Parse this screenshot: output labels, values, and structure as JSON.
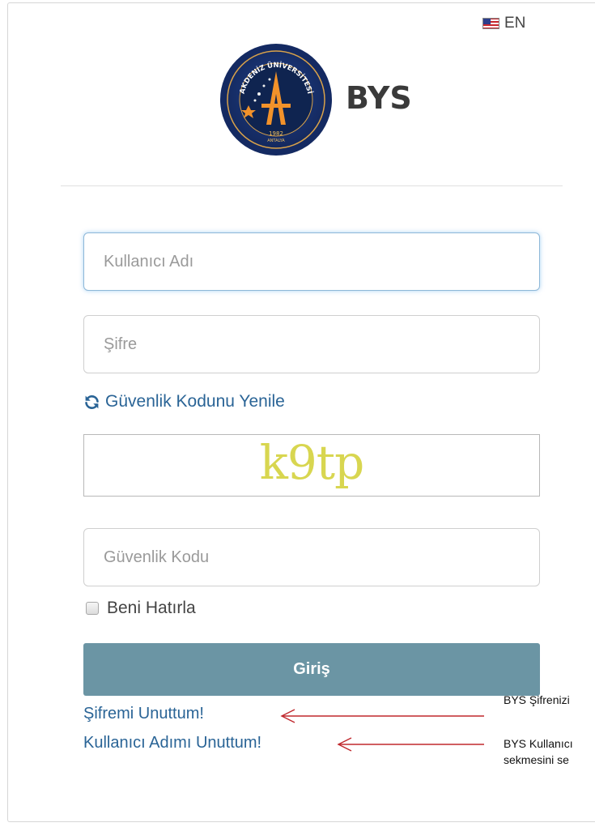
{
  "language": {
    "label": "EN",
    "flag": "us-flag-icon"
  },
  "logo": {
    "arc_text": "AKDENİZ ÜNİVERSİTESİ",
    "year": "1982",
    "city": "ANTALYA",
    "brand": "BYS"
  },
  "form": {
    "username_placeholder": "Kullanıcı Adı",
    "password_placeholder": "Şifre",
    "refresh_label": "Güvenlik Kodunu Yenile",
    "captcha_image_text": "k9tp",
    "captcha_placeholder": "Güvenlik Kodu",
    "remember_label": "Beni Hatırla",
    "submit_label": "Giriş",
    "forgot_password": "Şifremi Unuttum!",
    "forgot_username": "Kullanıcı Adımı Unuttum!"
  },
  "annotations": {
    "password_note": "BYS Şifrenizi",
    "username_note_line1": "BYS Kullanıcı",
    "username_note_line2": "sekmesini se"
  },
  "colors": {
    "primary_button": "#6b95a4",
    "link": "#2a6496",
    "annotation_arrow": "#c0282d",
    "captcha_text": "#d8d650"
  }
}
